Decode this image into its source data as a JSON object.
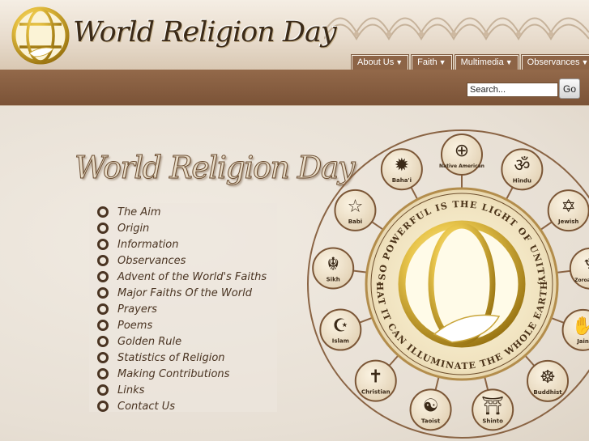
{
  "site": {
    "logo_text": "World Religion Day"
  },
  "nav": {
    "items": [
      {
        "label": "About Us"
      },
      {
        "label": "Faith"
      },
      {
        "label": "Multimedia"
      },
      {
        "label": "Observances"
      }
    ],
    "caret": "▼"
  },
  "search": {
    "placeholder": "Search...",
    "button_label": "Go"
  },
  "main": {
    "title": "World Religion Day",
    "menu": [
      "The Aim",
      "Origin",
      "Information",
      "Observances",
      "Advent of the World's Faiths",
      "Major Faiths Of the World",
      "Prayers",
      "Poems",
      "Golden Rule",
      "Statistics of Religion",
      "Making Contributions",
      "Links",
      "Contact Us"
    ]
  },
  "emblem": {
    "quote_top": "\"SO POWERFUL IS THE LIGHT OF UNITY,",
    "quote_bottom": "THAT IT CAN ILLUMINATE THE WHOLE EARTH\"",
    "faiths": [
      {
        "label": "Native American",
        "icon": "medicine-wheel-icon"
      },
      {
        "label": "Hindu",
        "icon": "om-icon"
      },
      {
        "label": "Jewish",
        "icon": "star-of-david-icon"
      },
      {
        "label": "Zoroastrian",
        "icon": "fire-altar-icon"
      },
      {
        "label": "Jain",
        "icon": "jain-hand-icon"
      },
      {
        "label": "Buddhist",
        "icon": "dharma-wheel-icon"
      },
      {
        "label": "Shinto",
        "icon": "torii-icon"
      },
      {
        "label": "Taoist",
        "icon": "yin-yang-icon"
      },
      {
        "label": "Christian",
        "icon": "cross-icon"
      },
      {
        "label": "Islam",
        "icon": "crescent-icon"
      },
      {
        "label": "Sikh",
        "icon": "khanda-icon"
      },
      {
        "label": "Babi",
        "icon": "five-point-star-icon"
      },
      {
        "label": "Baha'i",
        "icon": "nine-point-star-icon"
      }
    ]
  },
  "colors": {
    "brand_brown": "#7b5337",
    "gold": "#d8b23a",
    "background": "#e9e2d8"
  }
}
